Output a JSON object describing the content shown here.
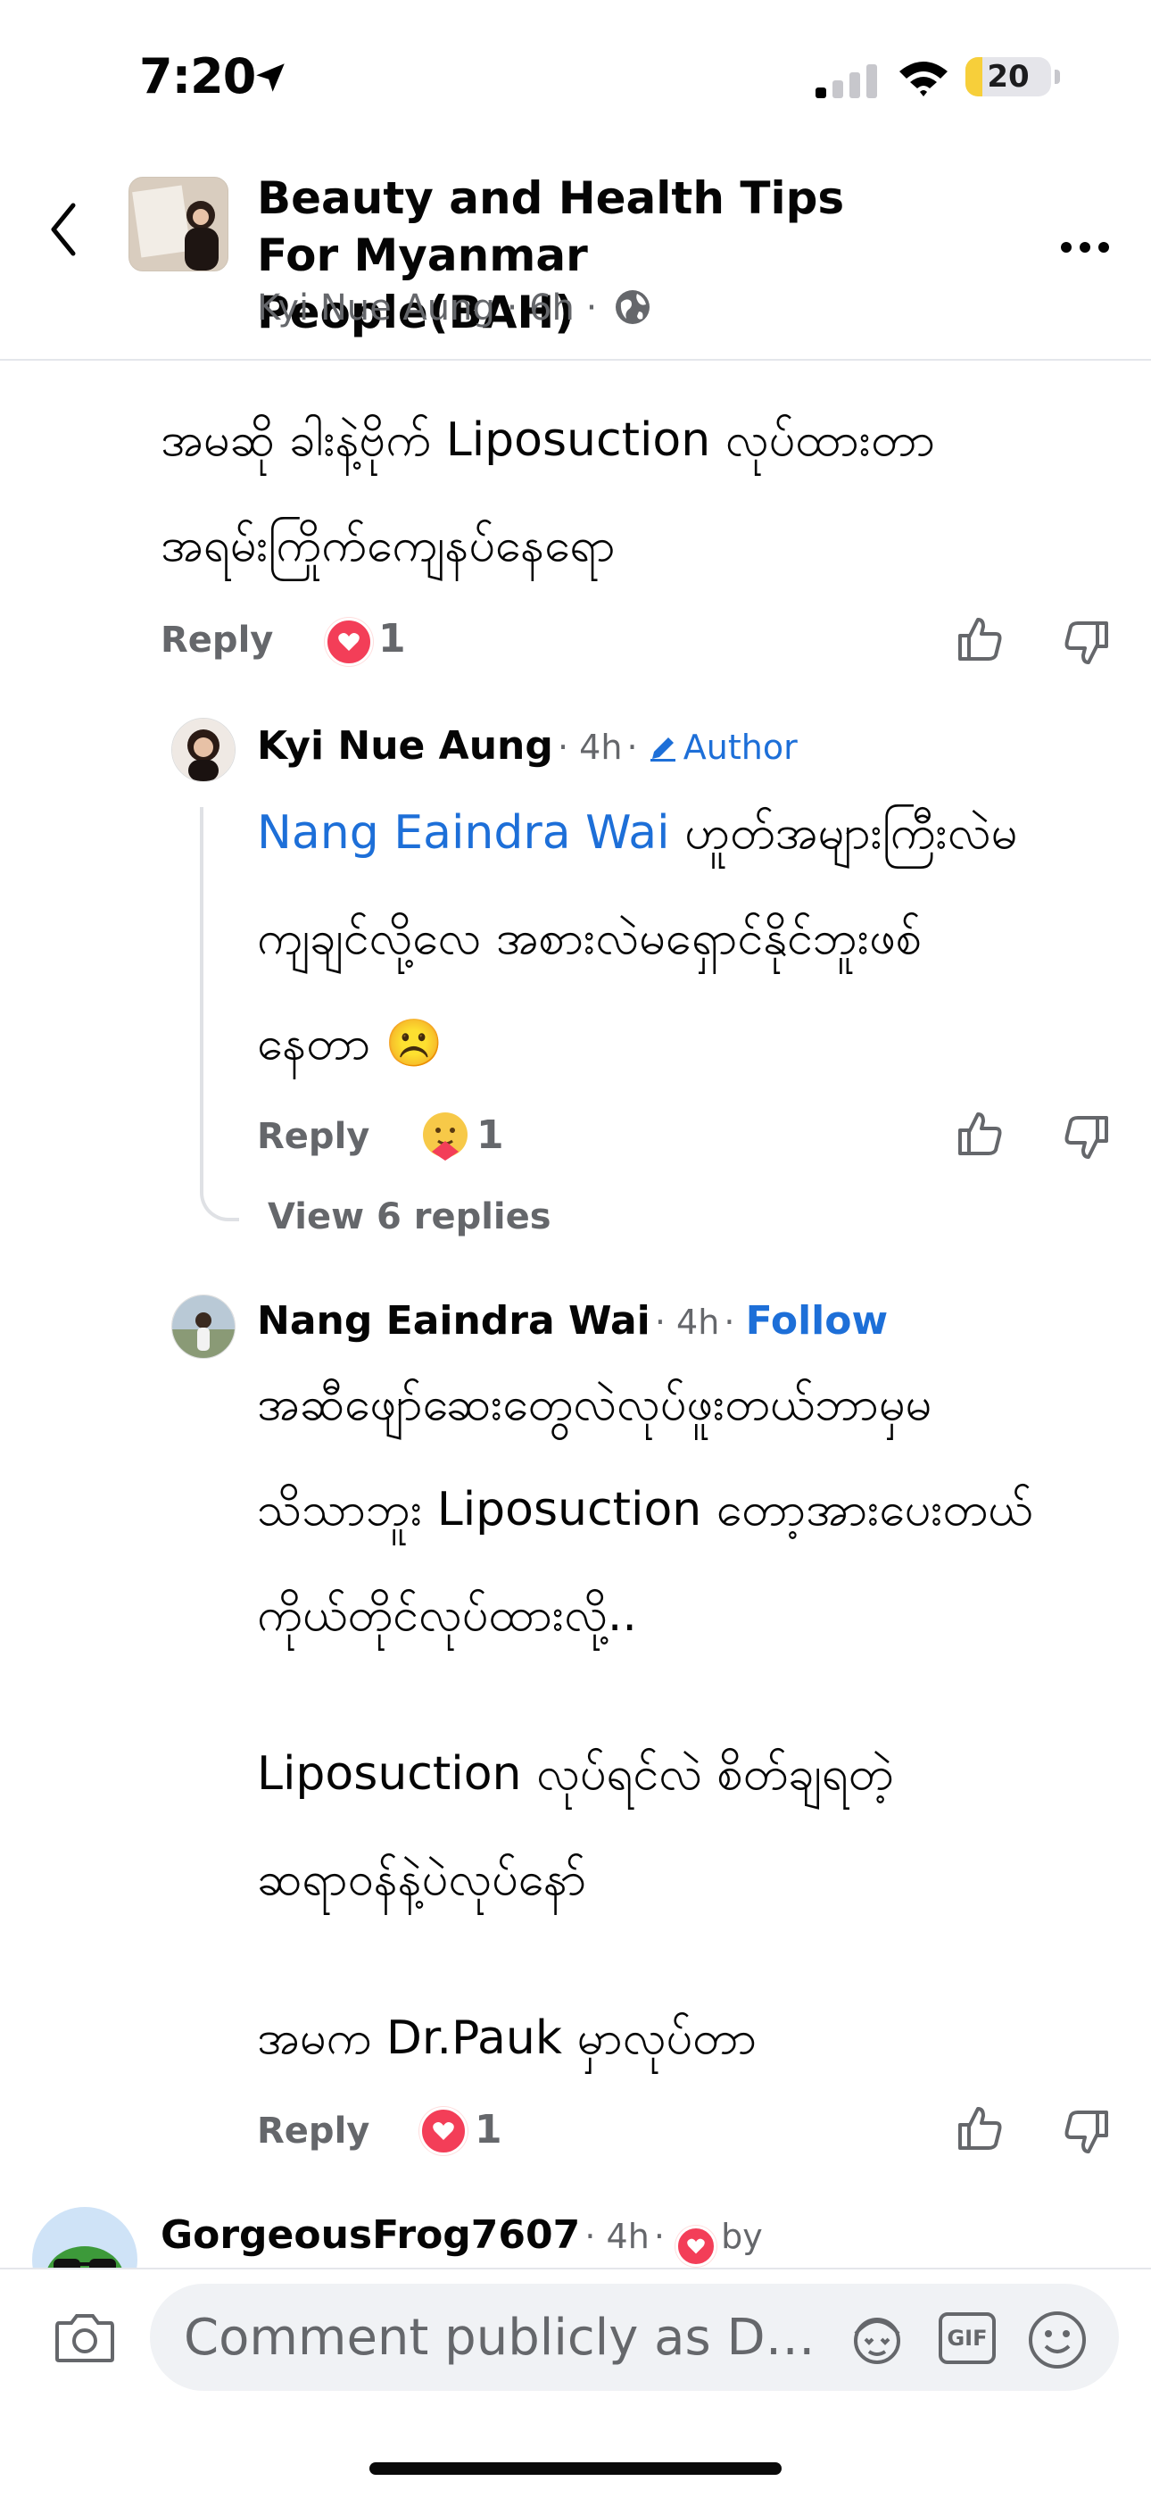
{
  "status_bar": {
    "time": "7:20",
    "battery": "20",
    "battery_fraction": 0.2,
    "battery_color": "#f7cf3a"
  },
  "header": {
    "group_name": "Beauty and Health Tips For Myanmar People(BAH)",
    "author": "Kyi Nue Aung",
    "time": "6h",
    "dot": "·"
  },
  "comments": [
    {
      "text_lines": [
        "အမဆို ခါးနဲ့ဗိုက် Liposuction လုပ်ထားတာ",
        "အရမ်းကြိုက်ကျေနပ်နေရော"
      ],
      "reply_label": "Reply",
      "reaction_count": "1"
    },
    {
      "name": "Kyi Nue Aung",
      "time": "4h",
      "badge": "Author",
      "mention": "Nang Eaindra Wai",
      "text_lines": [
        "ဟူတ်အများကြီးလဲမ",
        "ကျချင်လို့လေ အစားလဲမရှောင်နိုင်ဘူးဖစ်",
        "နေတာ ☹️"
      ],
      "reply_label": "Reply",
      "reaction_count": "1",
      "view_replies": "View 6 replies"
    },
    {
      "name": "Nang Eaindra Wai",
      "time": "4h",
      "follow_label": "Follow",
      "text_lines": [
        "အဆီဖျော်ဆေးတွေလဲလုပ်ဖူးတယ်ဘာမှမ",
        "သိသာဘူး Liposuction တော့အားပေးတယ်",
        "ကိုယ်တိုင်လုပ်ထားလို့..",
        "",
        "Liposuction လုပ်ရင်လဲ စိတ်ချရတဲ့",
        "ဆရာဝန်နဲ့ပဲလုပ်နော်",
        "",
        "အမက Dr.Pauk မှာလုပ်တာ"
      ],
      "reply_label": "Reply",
      "reaction_count": "1"
    },
    {
      "name": "GorgeousFrog7607",
      "time": "4h",
      "suffix": "by"
    }
  ],
  "composer": {
    "placeholder": "Comment publicly as Dr P...",
    "gif_label": "GIF"
  },
  "colors": {
    "link": "#1d6fd8",
    "heart": "#f33e58",
    "muted": "#65676b"
  }
}
